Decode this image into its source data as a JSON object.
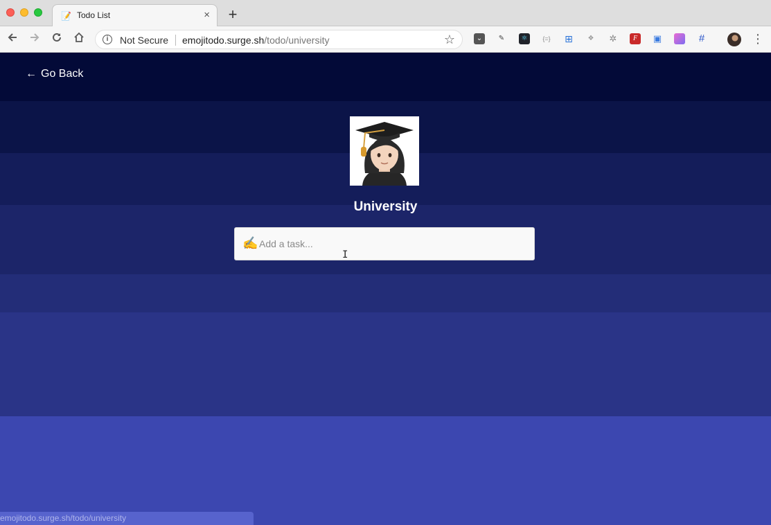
{
  "browser": {
    "tab": {
      "title": "Todo List",
      "favicon": "memo-emoji",
      "close_label": "×"
    },
    "new_tab_label": "+",
    "security_label": "Not Secure",
    "url_domain": "emojitodo.surge.sh",
    "url_path": "/todo/university",
    "extensions": [
      "pocket-icon",
      "eyedropper-icon",
      "react-devtools-icon",
      "json-viewer-icon",
      "grid-icon",
      "dropbox-icon",
      "settings-wheel-icon",
      "font-icon",
      "window-icon",
      "gradient-icon",
      "grid-frame-icon"
    ]
  },
  "page": {
    "go_back_arrow": "←",
    "go_back_label": "Go Back",
    "list_emoji": "woman-student-emoji",
    "list_title": "University",
    "task_emoji": "✍️",
    "task_placeholder": "Add a task...",
    "status_bar_url": "emojitodo.surge.sh/todo/university"
  },
  "colors": {
    "page_top": "#030a38",
    "page_bottom": "#3c47b0",
    "input_bg": "#f9f9f9"
  }
}
